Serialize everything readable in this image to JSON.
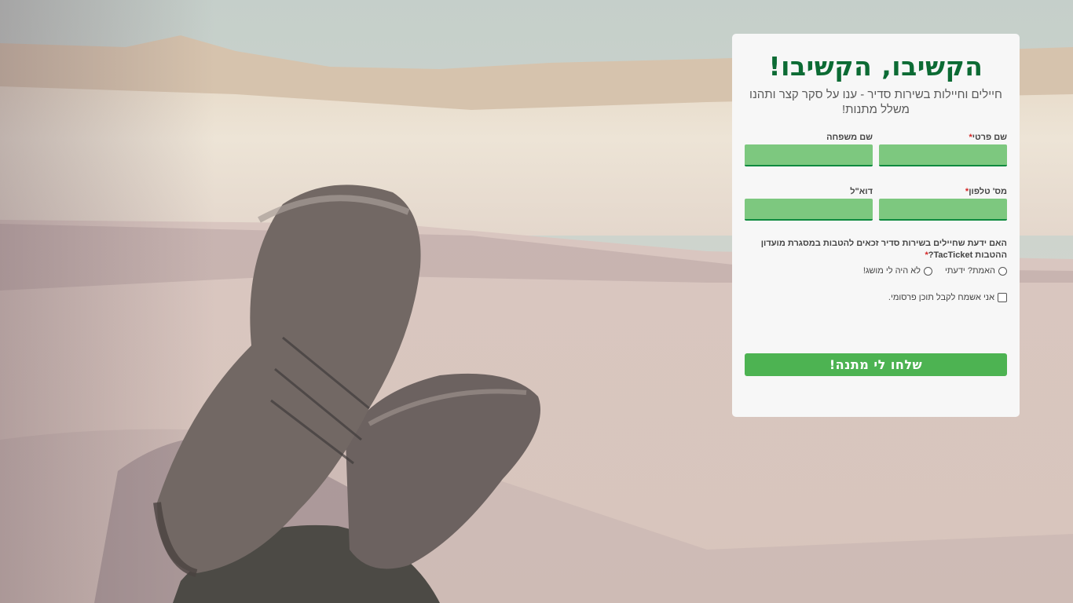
{
  "hero": {
    "title": "הקשיבו, הקשיבו!",
    "subtitle": "חיילים וחיילות בשירות סדיר - ענו על סקר קצר ותהנו משלל מתנות!"
  },
  "form": {
    "first_name_label": "שם פרטי",
    "last_name_label": "שם משפחה",
    "phone_label": "מס' טלפון",
    "email_label": "דוא\"ל",
    "required_mark": "*",
    "question": "האם ידעת שחיילים בשירות סדיר זכאים להטבות במסגרת מועדון ההטבות TacTicket?",
    "options": [
      "האמת? ידעתי",
      "לא היה לי מושג!"
    ],
    "consent_label": "אני אשמח לקבל תוכן פרסומי.",
    "submit_label": "שלחו לי מתנה!"
  },
  "colors": {
    "title": "#0c6b34",
    "input_fill": "#7dc87f",
    "button": "#4db352",
    "required": "#d42525"
  }
}
